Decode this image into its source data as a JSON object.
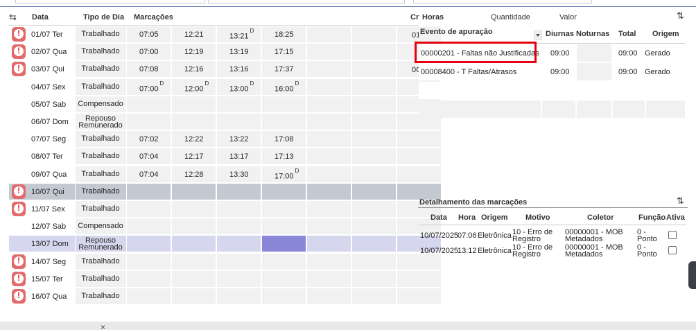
{
  "left_grid": {
    "headers": {
      "data": "Data",
      "tipo": "Tipo de Dia",
      "marcacoes": "Marcações",
      "cr": "Cr"
    },
    "rows": [
      {
        "data": "01/07 Ter",
        "tipo": "Trabalhado",
        "marks": [
          "07:05",
          "12:21",
          "13:21",
          "18:25"
        ],
        "d": [
          false,
          false,
          true,
          false
        ],
        "warn": true,
        "style": "normal"
      },
      {
        "data": "02/07 Qua",
        "tipo": "Trabalhado",
        "marks": [
          "07:00",
          "12:19",
          "13:19",
          "17:15"
        ],
        "d": [
          false,
          false,
          false,
          false
        ],
        "warn": true,
        "style": "normal"
      },
      {
        "data": "03/07 Qui",
        "tipo": "Trabalhado",
        "marks": [
          "07:08",
          "12:16",
          "13:16",
          "17:37"
        ],
        "d": [
          false,
          false,
          false,
          false
        ],
        "warn": true,
        "style": "normal"
      },
      {
        "data": "04/07 Sex",
        "tipo": "Trabalhado",
        "marks": [
          "07:00",
          "12:00",
          "13:00",
          "16:00"
        ],
        "d": [
          true,
          true,
          true,
          true
        ],
        "warn": false,
        "style": "normal"
      },
      {
        "data": "05/07 Sab",
        "tipo": "Compensado",
        "marks": [
          "",
          "",
          "",
          ""
        ],
        "d": [
          false,
          false,
          false,
          false
        ],
        "warn": false,
        "style": "normal"
      },
      {
        "data": "06/07 Dom",
        "tipo": "Repouso Remunerado",
        "marks": [
          "",
          "",
          "",
          ""
        ],
        "d": [
          false,
          false,
          false,
          false
        ],
        "warn": false,
        "style": "normal"
      },
      {
        "data": "07/07 Seg",
        "tipo": "Trabalhado",
        "marks": [
          "07:02",
          "12:22",
          "13:22",
          "17:08"
        ],
        "d": [
          false,
          false,
          false,
          false
        ],
        "warn": false,
        "style": "normal"
      },
      {
        "data": "08/07 Ter",
        "tipo": "Trabalhado",
        "marks": [
          "07:04",
          "12:17",
          "13:17",
          "17:13"
        ],
        "d": [
          false,
          false,
          false,
          false
        ],
        "warn": false,
        "style": "normal"
      },
      {
        "data": "09/07 Qua",
        "tipo": "Trabalhado",
        "marks": [
          "07:04",
          "12:28",
          "13:30",
          "17:00"
        ],
        "d": [
          false,
          false,
          false,
          true
        ],
        "warn": false,
        "style": "normal"
      },
      {
        "data": "10/07 Qui",
        "tipo": "Trabalhado",
        "marks": [
          "",
          "",
          "",
          ""
        ],
        "d": [
          false,
          false,
          false,
          false
        ],
        "warn": true,
        "style": "selected"
      },
      {
        "data": "11/07 Sex",
        "tipo": "Trabalhado",
        "marks": [
          "",
          "",
          "",
          ""
        ],
        "d": [
          false,
          false,
          false,
          false
        ],
        "warn": true,
        "style": "normal"
      },
      {
        "data": "12/07 Sab",
        "tipo": "Compensado",
        "marks": [
          "",
          "",
          "",
          ""
        ],
        "d": [
          false,
          false,
          false,
          false
        ],
        "warn": false,
        "style": "normal"
      },
      {
        "data": "13/07 Dom",
        "tipo": "Repouso Remunerado",
        "marks": [
          "",
          "",
          "",
          ""
        ],
        "d": [
          false,
          false,
          false,
          false
        ],
        "warn": false,
        "style": "lavender"
      },
      {
        "data": "14/07 Seg",
        "tipo": "Trabalhado",
        "marks": [
          "",
          "",
          "",
          ""
        ],
        "d": [
          false,
          false,
          false,
          false
        ],
        "warn": true,
        "style": "normal"
      },
      {
        "data": "15/07 Ter",
        "tipo": "Trabalhado",
        "marks": [
          "",
          "",
          "",
          ""
        ],
        "d": [
          false,
          false,
          false,
          false
        ],
        "warn": true,
        "style": "normal"
      },
      {
        "data": "16/07 Qua",
        "tipo": "Trabalhado",
        "marks": [
          "",
          "",
          "",
          ""
        ],
        "d": [
          false,
          false,
          false,
          false
        ],
        "warn": true,
        "style": "normal"
      }
    ],
    "cr_values": [
      "01",
      "",
      "0C"
    ],
    "d_label": "D",
    "warn_label": "!"
  },
  "right_header": {
    "horas": "Horas",
    "quantidade": "Quantidade",
    "valor": "Valor"
  },
  "events": {
    "headers": {
      "evento": "Evento de apuração",
      "diurnas": "Diurnas",
      "noturnas": "Noturnas",
      "total": "Total",
      "origem": "Origem"
    },
    "rows": [
      {
        "evento": "00000201 - Faltas não Justificadas",
        "diurnas": "09:00",
        "noturnas": "",
        "total": "09:00",
        "origem": "Gerado"
      },
      {
        "evento": "00008400 - T Faltas/Atrasos",
        "diurnas": "09:00",
        "noturnas": "",
        "total": "09:00",
        "origem": "Gerado"
      }
    ]
  },
  "details": {
    "title": "Detalhamento das marcações",
    "headers": {
      "data": "Data",
      "hora": "Hora",
      "origem": "Origem",
      "motivo": "Motivo",
      "coletor": "Coletor",
      "funcao": "Função",
      "ativa": "Ativa"
    },
    "rows": [
      {
        "data": "10/07/2025",
        "hora": "07:06",
        "origem": "Eletrônica",
        "motivo1": "10 - Erro de",
        "motivo2": "Registro",
        "coletor1": "00000001 - MOB",
        "coletor2": "Metadados",
        "funcao1": "0 -",
        "funcao2": "Ponto"
      },
      {
        "data": "10/07/2025",
        "hora": "13:12",
        "origem": "Eletrônica",
        "motivo1": "10 - Erro de",
        "motivo2": "Registro",
        "coletor1": "00000001 - MOB",
        "coletor2": "Metadados",
        "funcao1": "0 -",
        "funcao2": "Ponto"
      }
    ]
  },
  "icons": {
    "sort": "sort-arrows-icon",
    "swap": "swap-arrows-icon",
    "close": "close-icon",
    "warning": "warning-icon"
  },
  "colors": {
    "warn_bg": "#e26b6b",
    "selected_row": "#c4c9d1",
    "lavender_row": "#d6d7ee",
    "highlight_cell": "#8a87d9",
    "red_box": "#e3000f"
  },
  "bottom": {
    "close_glyph": "×"
  }
}
